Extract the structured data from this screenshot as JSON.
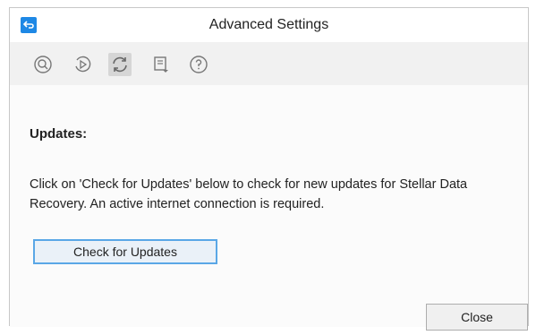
{
  "window": {
    "title": "Advanced Settings"
  },
  "toolbar": {
    "items": [
      {
        "icon": "scan-icon",
        "active": false
      },
      {
        "icon": "resume-recovery-icon",
        "active": false
      },
      {
        "icon": "update-icon",
        "active": true
      },
      {
        "icon": "advanced-options-icon",
        "active": false
      },
      {
        "icon": "help-icon",
        "active": false
      }
    ]
  },
  "updates": {
    "heading": "Updates:",
    "description": "Click on 'Check for Updates' below to check for new updates for Stellar Data Recovery. An active internet connection is required.",
    "check_button_label": "Check for Updates"
  },
  "footer": {
    "close_button_label": "Close"
  },
  "colors": {
    "accent": "#1e88e5",
    "toolbar_bg": "#f1f1f1",
    "focus_border": "#5aa7e6"
  }
}
